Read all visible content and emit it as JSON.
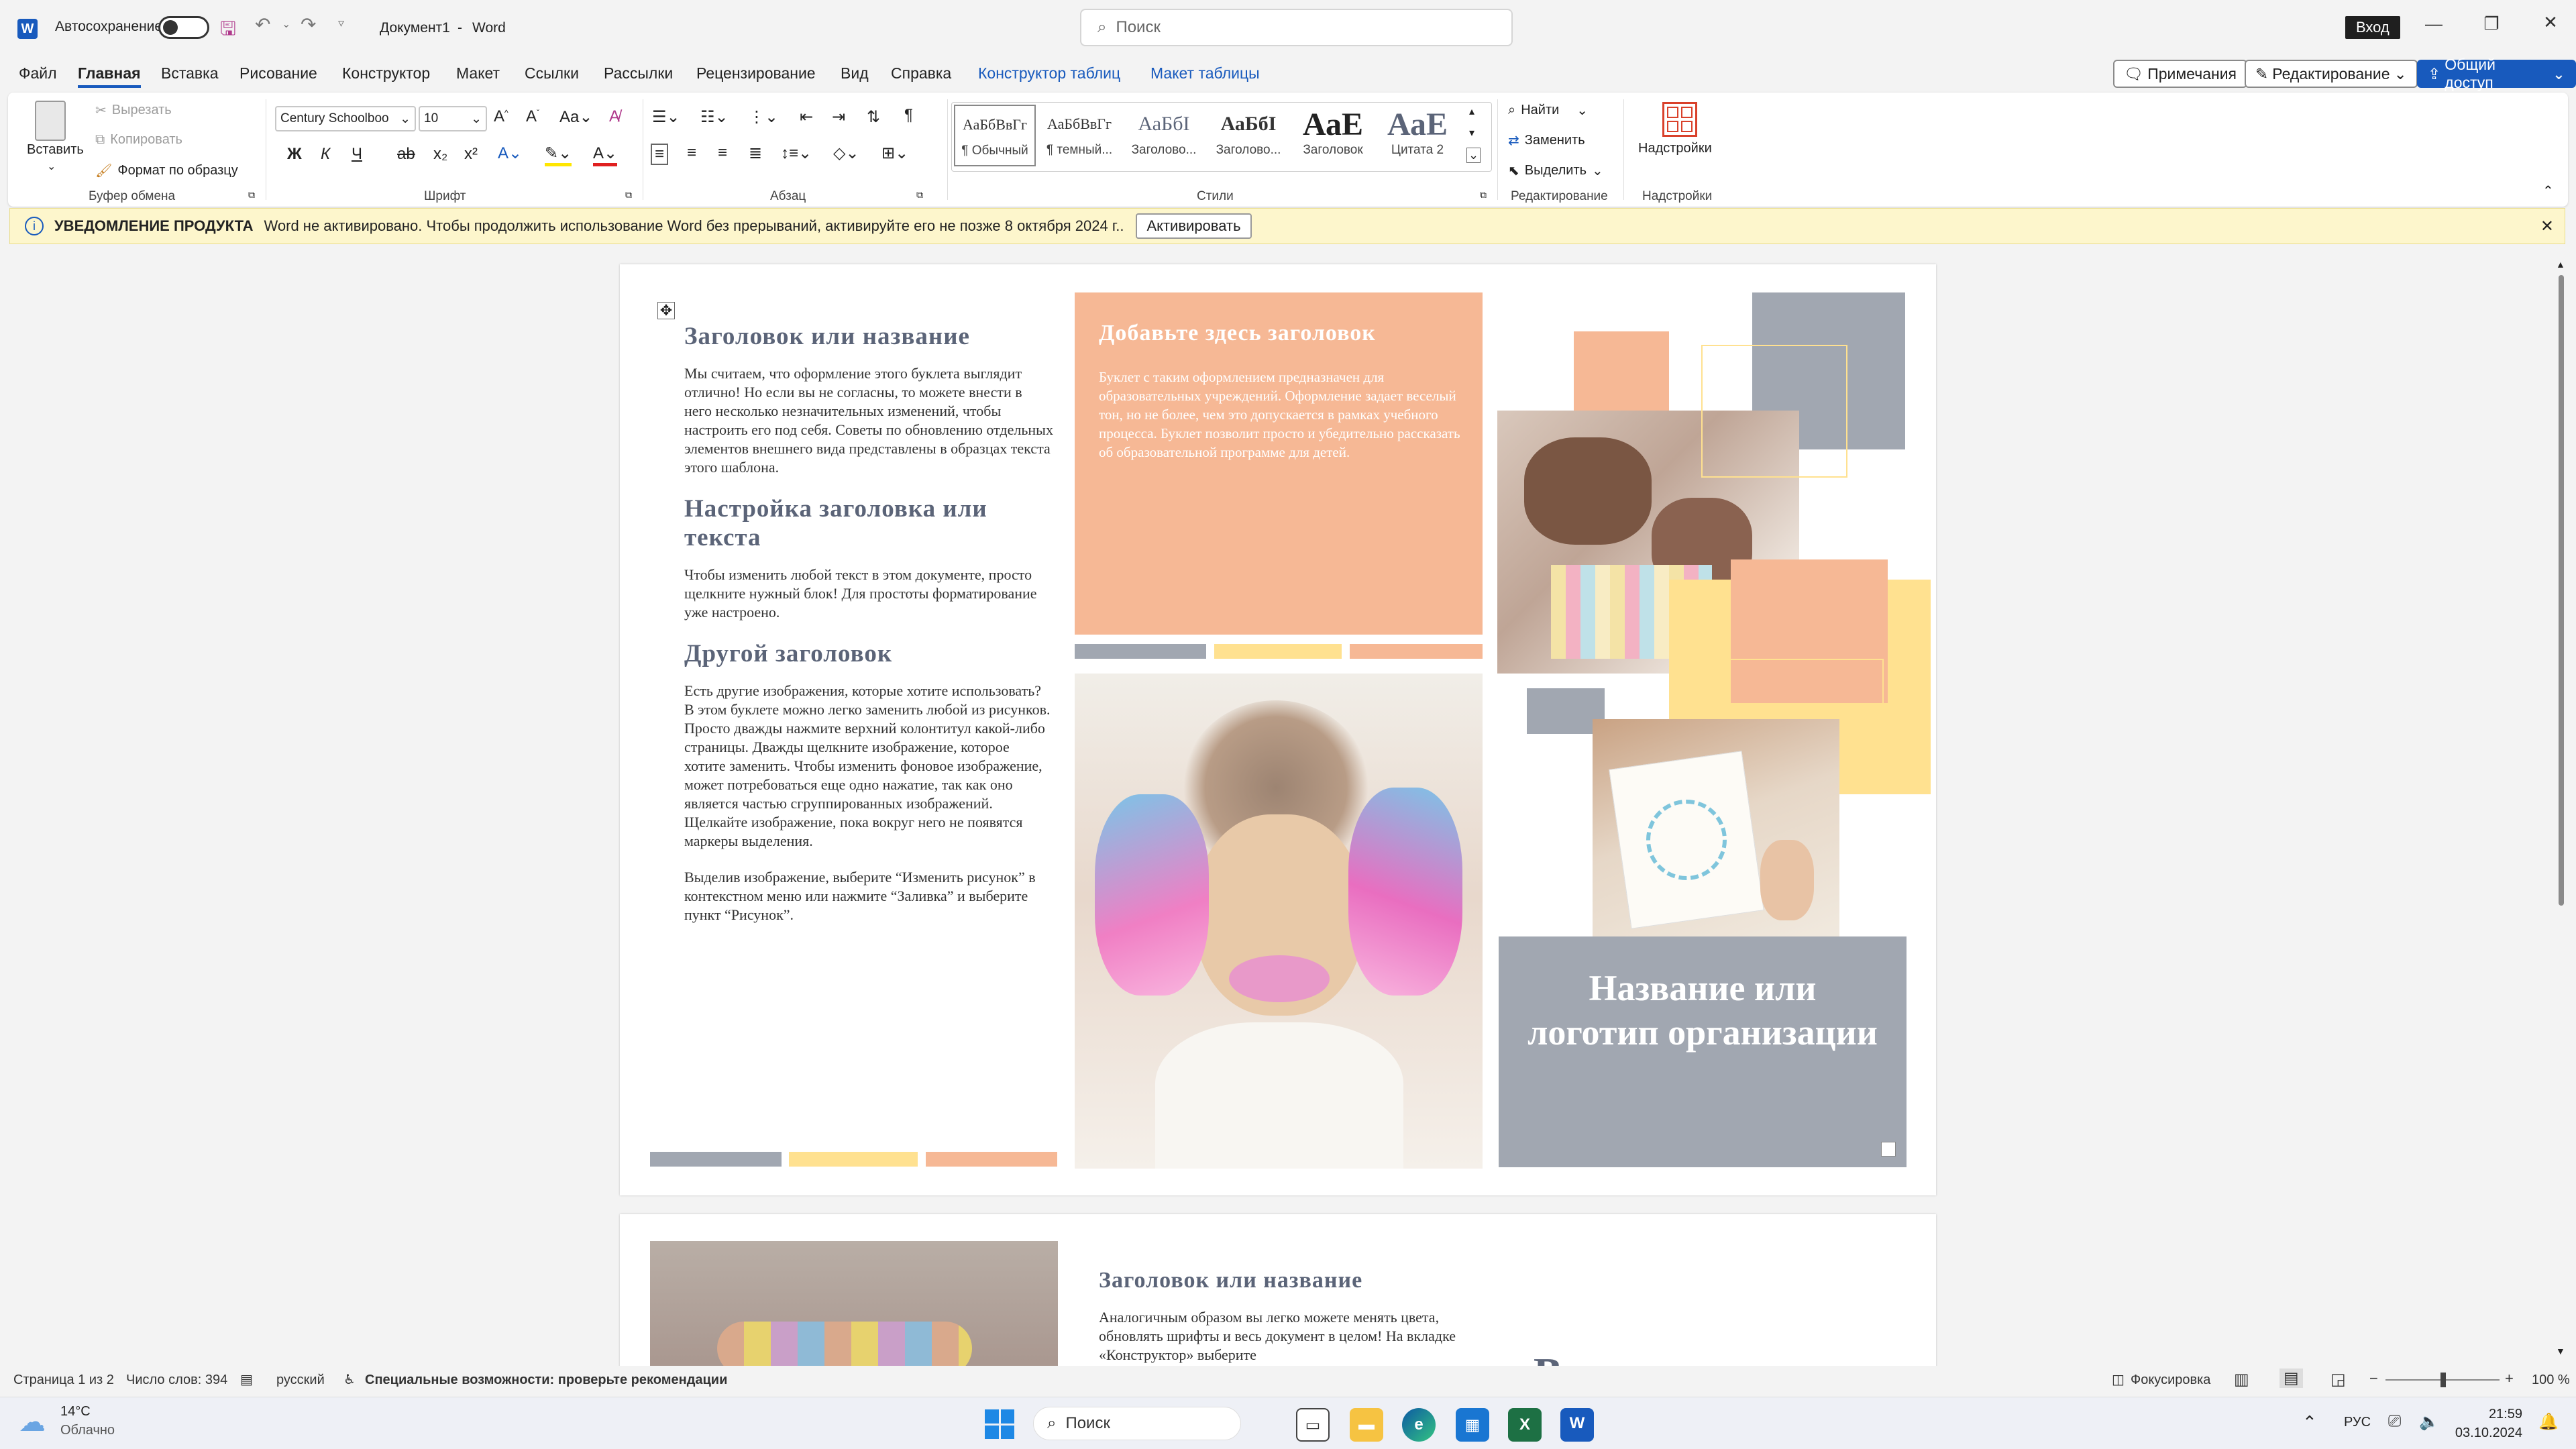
{
  "titlebar": {
    "autosave_label": "Автосохранение",
    "doc_title": "Документ1",
    "separator": "-",
    "app_name": "Word",
    "search_placeholder": "Поиск",
    "signin": "Вход"
  },
  "menu": {
    "items": [
      "Файл",
      "Главная",
      "Вставка",
      "Рисование",
      "Конструктор",
      "Макет",
      "Ссылки",
      "Рассылки",
      "Рецензирование",
      "Вид",
      "Справка",
      "Конструктор таблиц",
      "Макет таблицы"
    ],
    "comments": "Примечания",
    "editing": "Редактирование",
    "share": "Общий доступ"
  },
  "ribbon": {
    "clipboard": {
      "paste": "Вставить",
      "cut": "Вырезать",
      "copy": "Копировать",
      "format_painter": "Формат по образцу",
      "label": "Буфер обмена"
    },
    "font": {
      "name": "Century Schoolboo",
      "size": "10",
      "label": "Шрифт",
      "bold": "Ж",
      "italic": "К",
      "underline": "Ч",
      "strike": "ab",
      "sub": "x₂",
      "sup": "x²"
    },
    "paragraph": {
      "label": "Абзац"
    },
    "styles": {
      "label": "Стили",
      "tiles": [
        {
          "preview": "АаБбВвГг",
          "name": "¶ Обычный"
        },
        {
          "preview": "АаБбВвГг",
          "name": "¶ темный..."
        },
        {
          "preview": "АаБбІ",
          "name": "Заголово..."
        },
        {
          "preview": "АаБбІ",
          "name": "Заголово..."
        },
        {
          "preview": "АаЕ",
          "name": "Заголовок"
        },
        {
          "preview": "АаЕ",
          "name": "Цитата 2"
        }
      ]
    },
    "editing": {
      "find": "Найти",
      "replace": "Заменить",
      "select": "Выделить",
      "label": "Редактирование"
    },
    "addins": {
      "name": "Надстройки",
      "label": "Надстройки"
    }
  },
  "notification": {
    "title": "УВЕДОМЛЕНИЕ ПРОДУКТА",
    "text": "Word не активировано. Чтобы продолжить использование Word без прерываний, активируйте его не позже 8 октября 2024 г..",
    "button": "Активировать"
  },
  "page1": {
    "col1": {
      "h1": "Заголовок или название",
      "p1": "Мы считаем, что оформление этого буклета выглядит отлично! Но если вы не согласны, то можете внести в него несколько незначительных изменений, чтобы настроить его под себя. Советы по обновлению отдельных элементов внешнего вида представлены в образцах текста этого шаблона.",
      "h2": "Настройка заголовка или текста",
      "p2": "Чтобы изменить любой текст в этом документе, просто щелкните нужный блок! Для простоты форматирование уже настроено.",
      "h3": "Другой заголовок",
      "p3": "Есть другие изображения, которые хотите использовать? В этом буклете можно легко заменить любой из рисунков. Просто дважды нажмите верхний колонтитул какой-либо страницы. Дважды щелкните изображение, которое хотите заменить. Чтобы изменить фоновое изображение, может потребоваться еще одно нажатие, так как оно является частью сгруппированных изображений. Щелкайте изображение, пока вокруг него не появятся маркеры выделения.",
      "p4": "Выделив изображение, выберите “Изменить рисунок” в контекстном меню или нажмите “Заливка” и выберите пункт “Рисунок”."
    },
    "col2": {
      "h1": "Добавьте здесь заголовок",
      "p1": "Буклет с таким оформлением предназначен для образовательных учреждений. Оформление задает веселый тон, но не более, чем это допускается в рамках учебного процесса. Буклет позволит просто и убедительно рассказать об образовательной программе для детей."
    },
    "col3": {
      "org": "Название или логотип организации"
    }
  },
  "page2": {
    "h1": "Заголовок или название",
    "p1": "Аналогичным образом вы легко можете менять цвета, обновлять шрифты и весь документ в целом! На вкладке «Конструктор» выберите",
    "big": "«Вставьте здесь"
  },
  "status": {
    "page": "Страница 1 из 2",
    "words": "Число слов: 394",
    "lang": "русский",
    "accessibility": "Специальные возможности: проверьте рекомендации",
    "focus": "Фокусировка",
    "zoom": "100 %"
  },
  "taskbar": {
    "temp": "14°C",
    "weather": "Облачно",
    "search": "Поиск",
    "lang": "РУС",
    "time": "21:59",
    "date": "03.10.2024"
  },
  "colors": {
    "accent": "#185abd",
    "peach": "#f6b895",
    "gray": "#a1a7b1",
    "yellow": "#ffe190",
    "heading": "#5b6478"
  }
}
